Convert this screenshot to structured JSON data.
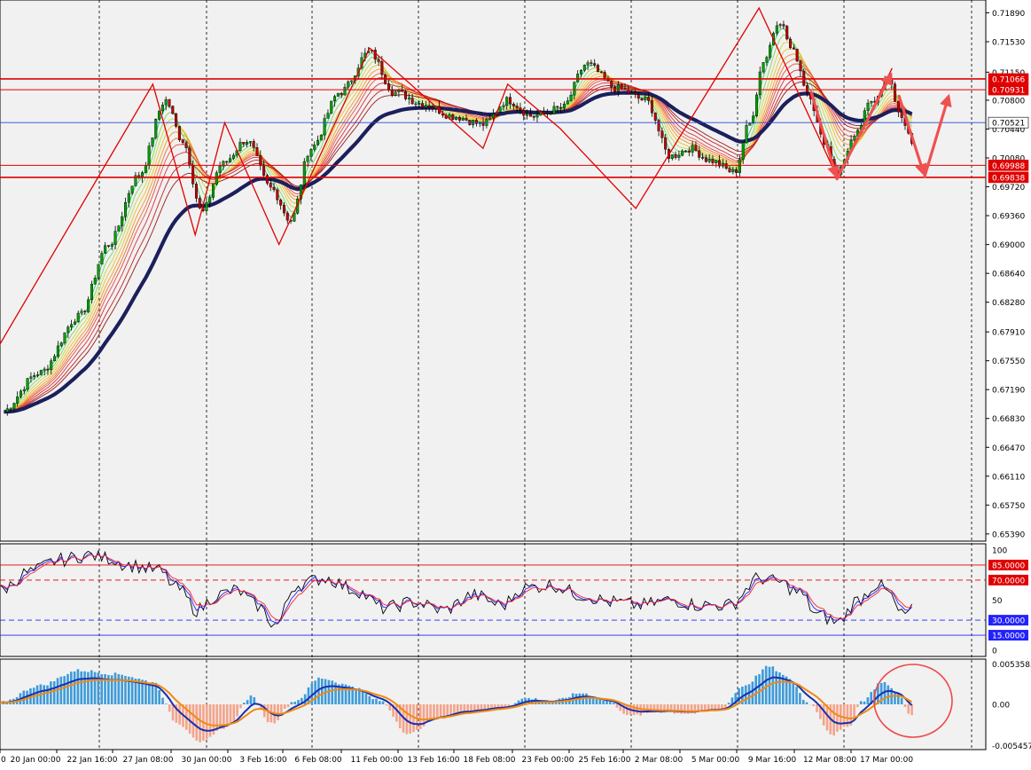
{
  "colors": {
    "background": "#ffffff",
    "plot_bg": "#f1f1f1",
    "grid": "#000000",
    "bull": "#00a000",
    "bear": "#c00000",
    "ma_slow": "#1c1f5c",
    "resistance": "#e00000",
    "support": "#e00000",
    "current_price_line": "#2a4bd0",
    "zigzag": "#e00000",
    "arrow": "#f05050",
    "stoch_k": "#000000",
    "stoch_d": "#2222ff",
    "stoch_slow": "#ff2222",
    "macd_pos": "#3d9bd9",
    "macd_neg": "#f4a38a",
    "macd_line": "#1a2fb0",
    "signal_line": "#f08a10",
    "circle": "#f04848"
  },
  "chart_data": [
    {
      "type": "candlestick",
      "panel": "price",
      "y_ticks": [
        "0.71890",
        "0.71530",
        "0.71150",
        "0.70800",
        "0.70440",
        "0.70080",
        "0.69720",
        "0.69360",
        "0.69000",
        "0.68640",
        "0.68280",
        "0.67910",
        "0.67550",
        "0.67190",
        "0.66830",
        "0.66470",
        "0.66110",
        "0.65750",
        "0.65390"
      ],
      "ylim": [
        0.653,
        0.7205
      ],
      "x_ticks": [
        "20 Jan 00:00",
        "22 Jan 16:00",
        "27 Jan 08:00",
        "30 Jan 00:00",
        "3 Feb 16:00",
        "6 Feb 08:00",
        "11 Feb 00:00",
        "13 Feb 16:00",
        "18 Feb 08:00",
        "23 Feb 00:00",
        "25 Feb 16:00",
        "2 Mar 08:00",
        "5 Mar 00:00",
        "9 Mar 16:00",
        "12 Mar 08:00",
        "17 Mar 00:00"
      ],
      "price_labels": [
        {
          "value": 0.71066,
          "text": "0.71066",
          "kind": "resistance"
        },
        {
          "value": 0.70931,
          "text": "0.70931",
          "kind": "resistance"
        },
        {
          "value": 0.70521,
          "text": "0.70521",
          "kind": "current"
        },
        {
          "value": 0.69988,
          "text": "0.69988",
          "kind": "support"
        },
        {
          "value": 0.69838,
          "text": "0.69838",
          "kind": "support"
        }
      ],
      "zigzag": [
        [
          -0.01,
          0.6755
        ],
        [
          0.155,
          0.71
        ],
        [
          0.198,
          0.6912
        ],
        [
          0.228,
          0.7052
        ],
        [
          0.283,
          0.69
        ],
        [
          0.375,
          0.7145
        ],
        [
          0.49,
          0.702
        ],
        [
          0.515,
          0.71
        ],
        [
          0.568,
          0.7045
        ],
        [
          0.645,
          0.6945
        ],
        [
          0.77,
          0.7195
        ],
        [
          0.85,
          0.6982
        ],
        [
          0.905,
          0.712
        ]
      ],
      "projection_arrows": [
        {
          "from": [
            0.823,
            0.709
          ],
          "to": [
            0.849,
            0.6982
          ]
        },
        {
          "from": [
            0.849,
            0.6982
          ],
          "to": [
            0.905,
            0.7115
          ]
        },
        {
          "from": [
            0.912,
            0.7085
          ],
          "to": [
            0.938,
            0.6985
          ]
        },
        {
          "from": [
            0.938,
            0.6985
          ],
          "to": [
            0.963,
            0.7088
          ]
        }
      ],
      "series_anchors": [
        [
          0.0,
          0.669
        ],
        [
          0.04,
          0.674
        ],
        [
          0.08,
          0.681
        ],
        [
          0.11,
          0.69
        ],
        [
          0.14,
          0.6985
        ],
        [
          0.168,
          0.708
        ],
        [
          0.185,
          0.703
        ],
        [
          0.205,
          0.694
        ],
        [
          0.225,
          0.7
        ],
        [
          0.25,
          0.703
        ],
        [
          0.275,
          0.697
        ],
        [
          0.295,
          0.693
        ],
        [
          0.315,
          0.702
        ],
        [
          0.345,
          0.709
        ],
        [
          0.375,
          0.714
        ],
        [
          0.4,
          0.709
        ],
        [
          0.43,
          0.7075
        ],
        [
          0.46,
          0.706
        ],
        [
          0.49,
          0.705
        ],
        [
          0.515,
          0.708
        ],
        [
          0.54,
          0.706
        ],
        [
          0.57,
          0.707
        ],
        [
          0.595,
          0.7125
        ],
        [
          0.625,
          0.7095
        ],
        [
          0.655,
          0.708
        ],
        [
          0.68,
          0.701
        ],
        [
          0.7,
          0.702
        ],
        [
          0.72,
          0.7005
        ],
        [
          0.745,
          0.699
        ],
        [
          0.76,
          0.705
        ],
        [
          0.775,
          0.713
        ],
        [
          0.79,
          0.718
        ],
        [
          0.805,
          0.714
        ],
        [
          0.82,
          0.709
        ],
        [
          0.835,
          0.703
        ],
        [
          0.85,
          0.699
        ],
        [
          0.865,
          0.703
        ],
        [
          0.885,
          0.708
        ],
        [
          0.9,
          0.7105
        ],
        [
          0.915,
          0.706
        ],
        [
          0.925,
          0.7025
        ]
      ]
    },
    {
      "type": "line",
      "panel": "stochastic",
      "y_ticks": [
        "100",
        "85.0000",
        "70.0000",
        "50",
        "30.0000",
        "15.0000",
        "0"
      ],
      "ylim": [
        0,
        100
      ],
      "levels": [
        {
          "value": 85,
          "text": "85.0000",
          "color": "#e00000",
          "dash": false
        },
        {
          "value": 70,
          "text": "70.0000",
          "color": "#e00000",
          "dash": true
        },
        {
          "value": 30,
          "text": "30.0000",
          "color": "#2222ff",
          "dash": true
        },
        {
          "value": 15,
          "text": "15.0000",
          "color": "#2222ff",
          "dash": false
        }
      ],
      "series_anchors": [
        [
          0.0,
          60
        ],
        [
          0.03,
          78
        ],
        [
          0.06,
          90
        ],
        [
          0.09,
          95
        ],
        [
          0.11,
          92
        ],
        [
          0.13,
          85
        ],
        [
          0.16,
          80
        ],
        [
          0.18,
          62
        ],
        [
          0.2,
          40
        ],
        [
          0.22,
          55
        ],
        [
          0.24,
          60
        ],
        [
          0.26,
          45
        ],
        [
          0.28,
          25
        ],
        [
          0.3,
          65
        ],
        [
          0.33,
          72
        ],
        [
          0.36,
          60
        ],
        [
          0.39,
          42
        ],
        [
          0.42,
          48
        ],
        [
          0.45,
          40
        ],
        [
          0.48,
          55
        ],
        [
          0.51,
          45
        ],
        [
          0.53,
          62
        ],
        [
          0.56,
          65
        ],
        [
          0.59,
          55
        ],
        [
          0.62,
          48
        ],
        [
          0.65,
          45
        ],
        [
          0.68,
          50
        ],
        [
          0.71,
          45
        ],
        [
          0.74,
          45
        ],
        [
          0.77,
          72
        ],
        [
          0.79,
          68
        ],
        [
          0.81,
          58
        ],
        [
          0.83,
          35
        ],
        [
          0.85,
          28
        ],
        [
          0.87,
          50
        ],
        [
          0.89,
          66
        ],
        [
          0.9,
          58
        ],
        [
          0.915,
          35
        ],
        [
          0.925,
          40
        ]
      ]
    },
    {
      "type": "bar",
      "panel": "macd",
      "y_ticks": [
        "0.0053585",
        "0.00",
        "-0.005457"
      ],
      "ylim": [
        -0.006,
        0.006
      ],
      "series_anchors": [
        [
          0.0,
          0.0002
        ],
        [
          0.04,
          0.0025
        ],
        [
          0.08,
          0.0045
        ],
        [
          0.12,
          0.004
        ],
        [
          0.155,
          0.003
        ],
        [
          0.18,
          -0.0025
        ],
        [
          0.205,
          -0.005
        ],
        [
          0.23,
          -0.003
        ],
        [
          0.255,
          0.001
        ],
        [
          0.275,
          -0.0025
        ],
        [
          0.3,
          0.0005
        ],
        [
          0.325,
          0.0035
        ],
        [
          0.355,
          0.0025
        ],
        [
          0.385,
          0.0005
        ],
        [
          0.415,
          -0.004
        ],
        [
          0.44,
          -0.002
        ],
        [
          0.47,
          -0.001
        ],
        [
          0.505,
          -0.0005
        ],
        [
          0.535,
          0.0008
        ],
        [
          0.56,
          0.0004
        ],
        [
          0.59,
          0.0015
        ],
        [
          0.615,
          0.0005
        ],
        [
          0.64,
          -0.0015
        ],
        [
          0.67,
          -0.001
        ],
        [
          0.7,
          -0.0012
        ],
        [
          0.73,
          -0.0008
        ],
        [
          0.755,
          0.0025
        ],
        [
          0.78,
          0.005
        ],
        [
          0.8,
          0.0035
        ],
        [
          0.82,
          0.0002
        ],
        [
          0.845,
          -0.004
        ],
        [
          0.86,
          -0.003
        ],
        [
          0.875,
          0.0005
        ],
        [
          0.895,
          0.003
        ],
        [
          0.91,
          0.0015
        ],
        [
          0.925,
          -0.0015
        ]
      ]
    }
  ]
}
